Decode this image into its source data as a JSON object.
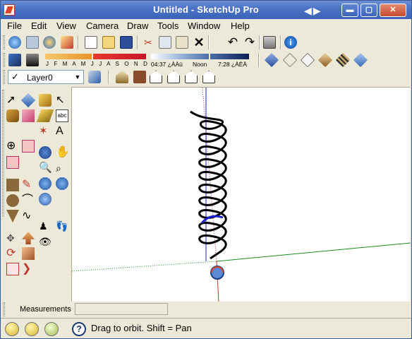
{
  "window": {
    "title": "Untitled - SketchUp Pro",
    "nav_arrows": "◀▶",
    "controls": {
      "minimize": "▬",
      "maximize": "▢",
      "close": "✕"
    }
  },
  "menu": {
    "items": [
      {
        "label": "File"
      },
      {
        "label": "Edit"
      },
      {
        "label": "View"
      },
      {
        "label": "Camera"
      },
      {
        "label": "Draw"
      },
      {
        "label": "Tools"
      },
      {
        "label": "Window"
      },
      {
        "label": "Help"
      }
    ]
  },
  "shadow_toolbar": {
    "months_label": "J F M A M J J A S O N D",
    "sunrise_time": "04:37 ¿ÀÀü",
    "noon_label": "Noon",
    "sunset_time": "7:28 ¿ÀÈÄ"
  },
  "layers": {
    "current_layer": "Layer0",
    "check_glyph": "✓",
    "dropdown_glyph": "▼"
  },
  "measurements": {
    "label": "Measurements",
    "value": ""
  },
  "status": {
    "help_glyph": "?",
    "message": "Drag to orbit.  Shift = Pan"
  },
  "colors": {
    "axis_red": "#c0392b",
    "axis_green": "#1a8f1a",
    "axis_blue": "#1c1cc8",
    "title_bar": "#3a63b8"
  }
}
